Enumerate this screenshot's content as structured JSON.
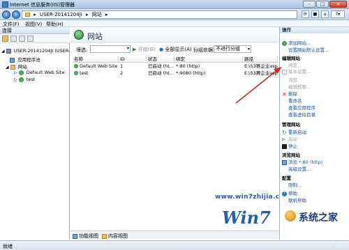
{
  "window": {
    "title": "Internet 信息服务(IIS)管理器",
    "controls": [
      "-",
      "□",
      "×"
    ]
  },
  "address": {
    "path": [
      "USER-20141204JI",
      "网站"
    ],
    "separator": "▸"
  },
  "menu": [
    "文件(F)",
    "视图(V)",
    "帮助(H)"
  ],
  "left_panel": {
    "header": "连接",
    "tree": [
      {
        "label": "USER-20141204JI (USER-20",
        "level": 0
      },
      {
        "label": "应用程序池",
        "level": 1
      },
      {
        "label": "网站",
        "level": 1
      },
      {
        "label": "Default Web Site",
        "level": 2
      },
      {
        "label": "test",
        "level": 2
      }
    ]
  },
  "center": {
    "title": "网站",
    "filter_label": "筛选:",
    "start_label": "开始(G)",
    "show_all_label": "全部显示(A)",
    "group_label": "分组依据:",
    "group_value": "不进行分组",
    "columns": [
      "名称",
      "ID",
      "状态",
      "绑定",
      "路径"
    ],
    "rows": [
      [
        "Default Web Site",
        "1",
        "已启动 (ht...",
        "*:80 (http)",
        "E:\\53赛企业asp"
      ],
      [
        "test",
        "2",
        "已启动 (ht...",
        "*:9080 (http)",
        "E:\\53赛企业asp"
      ]
    ],
    "bottom_tabs": [
      "功能视图",
      "内容视图"
    ]
  },
  "actions": {
    "header": "操作",
    "groups": [
      {
        "items": [
          {
            "label": "添加网站...",
            "state": "link"
          },
          {
            "label": "设置网站默认设置...",
            "state": "link"
          }
        ]
      },
      {
        "title": "编辑网站",
        "items": [
          {
            "label": "绑定...",
            "state": "disabled"
          },
          {
            "label": "基本设置...",
            "state": "disabled"
          },
          {
            "label": "浏览",
            "state": "disabled"
          },
          {
            "label": "编辑权限...",
            "state": "disabled"
          },
          {
            "label": "删除",
            "state": "link"
          },
          {
            "label": "重命名",
            "state": "link"
          },
          {
            "label": "查看应用程序",
            "state": "link"
          },
          {
            "label": "查看虚拟目录",
            "state": "link"
          }
        ]
      },
      {
        "title": "管理网站",
        "items": [
          {
            "label": "重新启动",
            "state": "link"
          },
          {
            "label": "启动",
            "state": "disabled"
          },
          {
            "label": "停止",
            "state": "link"
          }
        ]
      },
      {
        "title": "浏览网站",
        "items": [
          {
            "label": "浏览 *:80 (http)",
            "state": "link"
          },
          {
            "label": "高级设置...",
            "state": "link"
          }
        ]
      },
      {
        "title": "配置",
        "items": [
          {
            "label": "限制...",
            "state": "link"
          }
        ]
      },
      {
        "items": [
          {
            "label": "帮助",
            "state": "link"
          },
          {
            "label": "联机帮助",
            "state": "link"
          }
        ]
      }
    ]
  },
  "status": {
    "text": "就绪"
  },
  "watermark": {
    "logo_text": "Win7",
    "site": "www.win7zhijia.cn",
    "brand": "系统之家"
  },
  "colors": {
    "link": "#1a4f9c",
    "disabled": "#9aa0a8",
    "arrow": "#d8281e",
    "accent": "#2d6db3"
  }
}
